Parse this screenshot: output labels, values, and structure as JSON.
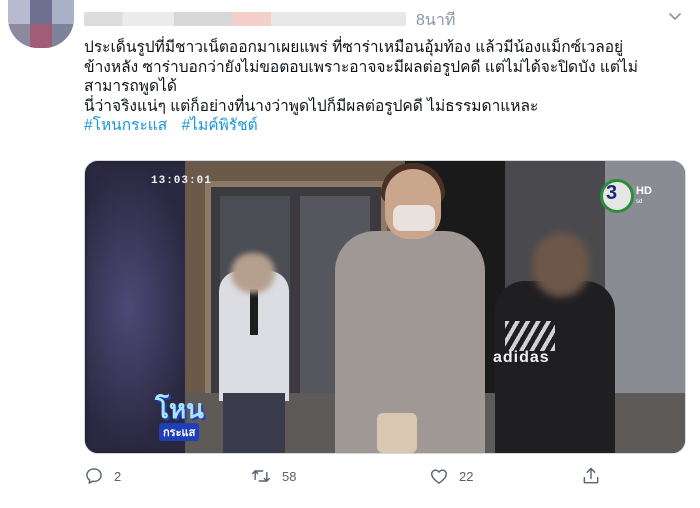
{
  "tweet": {
    "time": "8นาที",
    "lines": [
      "ประเด็นรูปที่มีชาวเน็ตออกมาเผยแพร่ ที่ซาร่าเหมือนอุ้มท้อง แล้วมีน้องแม็กซ์เวลอยู่",
      "ข้างหลัง ซาร่าบอกว่ายังไม่ขอตอบเพราะอาจจะมีผลต่อรูปคดี แต่ไม่ได้จะปิดบัง แต่ไม่",
      "สามารถพูดได้",
      "นี่ว่าจริงแน่ๆ แต่ก็อย่างที่นางว่าพูดไปก็มีผลต่อรูปคดี ไม่ธรรมดาแหละ"
    ],
    "hashtags": [
      "#โหนกระแส",
      "#ไมค์พิรัชต์"
    ]
  },
  "media": {
    "timestamp": "13:03:01",
    "channel": "3",
    "channel_hd": "HD",
    "channel_sub": "sd",
    "show_top": "โหน",
    "show_bottom": "กระแส",
    "shirt_text": "adidas"
  },
  "actions": {
    "reply_count": "2",
    "retweet_count": "58",
    "like_count": "22"
  },
  "colors": {
    "link": "#1b95e0",
    "muted": "#8b98a5",
    "icon": "#536471"
  },
  "icons": [
    "caret-down-icon",
    "reply-icon",
    "retweet-icon",
    "like-icon",
    "share-icon"
  ]
}
